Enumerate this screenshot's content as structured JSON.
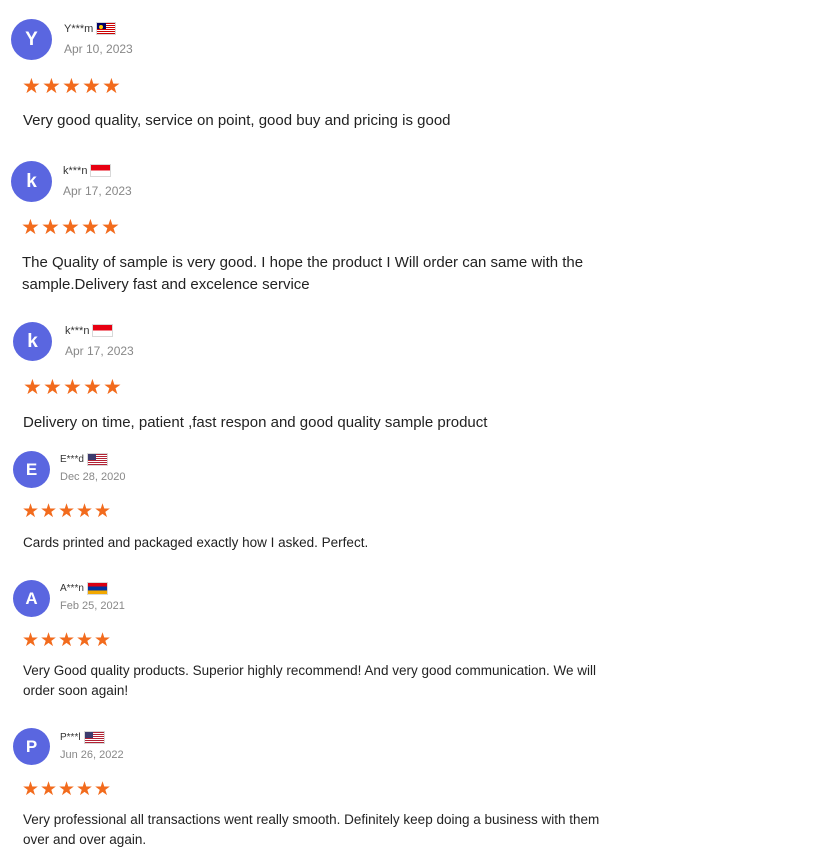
{
  "reviews": [
    {
      "avatar_letter": "Y",
      "name": "Y***m",
      "flag": "malaysia-flag-icon",
      "date": "Apr 10, 2023",
      "rating": 5,
      "text_lines": [
        "Very good quality, service on point, good buy and pricing is good"
      ]
    },
    {
      "avatar_letter": "k",
      "name": "k***n",
      "flag": "indonesia-flag-icon",
      "date": "Apr 17, 2023",
      "rating": 5,
      "text_lines": [
        "The Quality of sample is very good. I hope the product I Will order can same with the",
        "sample.Delivery fast and excelence service"
      ]
    },
    {
      "avatar_letter": "k",
      "name": "k***n",
      "flag": "indonesia-flag-icon",
      "date": "Apr 17, 2023",
      "rating": 5,
      "text_lines": [
        "Delivery on time, patient ,fast respon and good quality sample product"
      ]
    },
    {
      "avatar_letter": "E",
      "name": "E***d",
      "flag": "united-states-flag-icon",
      "date": "Dec 28, 2020",
      "rating": 5,
      "text_lines": [
        "Cards printed and packaged exactly how I asked. Perfect."
      ]
    },
    {
      "avatar_letter": "A",
      "name": "A***n",
      "flag": "armenia-flag-icon",
      "date": "Feb 25, 2021",
      "rating": 5,
      "text_lines": [
        "Very Good quality products. Superior highly recommend! And very good communication. We will",
        "order soon again!"
      ]
    },
    {
      "avatar_letter": "P",
      "name": "P***l",
      "flag": "united-states-flag-icon",
      "date": "Jun 26, 2022",
      "rating": 5,
      "text_lines": [
        "Very professional all transactions went really smooth. Definitely keep doing a business with them",
        "over and over again."
      ]
    }
  ],
  "colors": {
    "avatar": "#5a66e0",
    "star": "#f26b1d",
    "date": "#888888"
  }
}
